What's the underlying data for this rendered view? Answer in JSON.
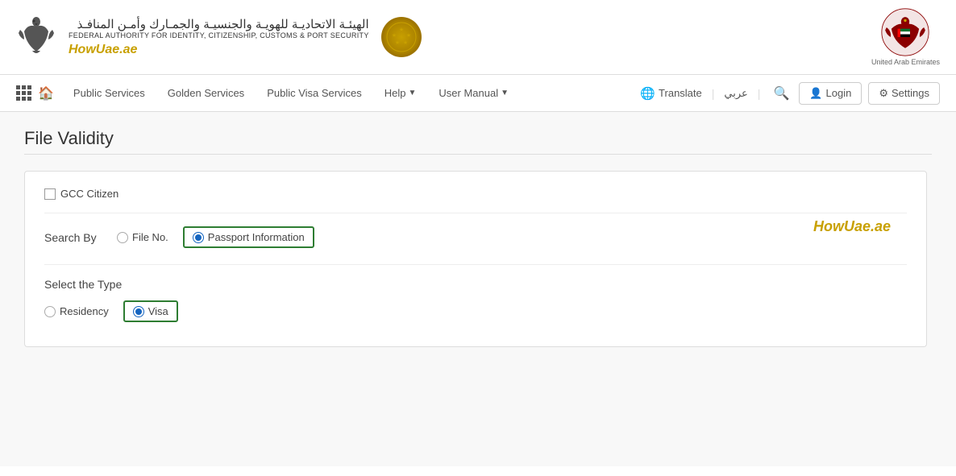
{
  "header": {
    "arabic_name": "الهيئـة الاتحاديـة للهويـة والجنسيـة والجمـارك وأمـن المنافـذ",
    "english_name": "FEDERAL AUTHORITY FOR IDENTITY, CITIZENSHIP, CUSTOMS & PORT SECURITY",
    "how_uae": "HowUae.ae",
    "uae_label": "United Arab Emirates"
  },
  "navbar": {
    "public_services": "Public Services",
    "golden_services": "Golden Services",
    "public_visa_services": "Public Visa Services",
    "help": "Help",
    "user_manual": "User Manual",
    "translate": "Translate",
    "arabic": "عربي",
    "login": "Login",
    "settings": "Settings"
  },
  "page": {
    "title": "File Validity"
  },
  "form": {
    "gcc_label": "GCC Citizen",
    "search_by_label": "Search By",
    "file_no_label": "File No.",
    "passport_info_label": "Passport Information",
    "watermark": "HowUae.ae",
    "select_type_label": "Select the Type",
    "residency_label": "Residency",
    "visa_label": "Visa"
  }
}
